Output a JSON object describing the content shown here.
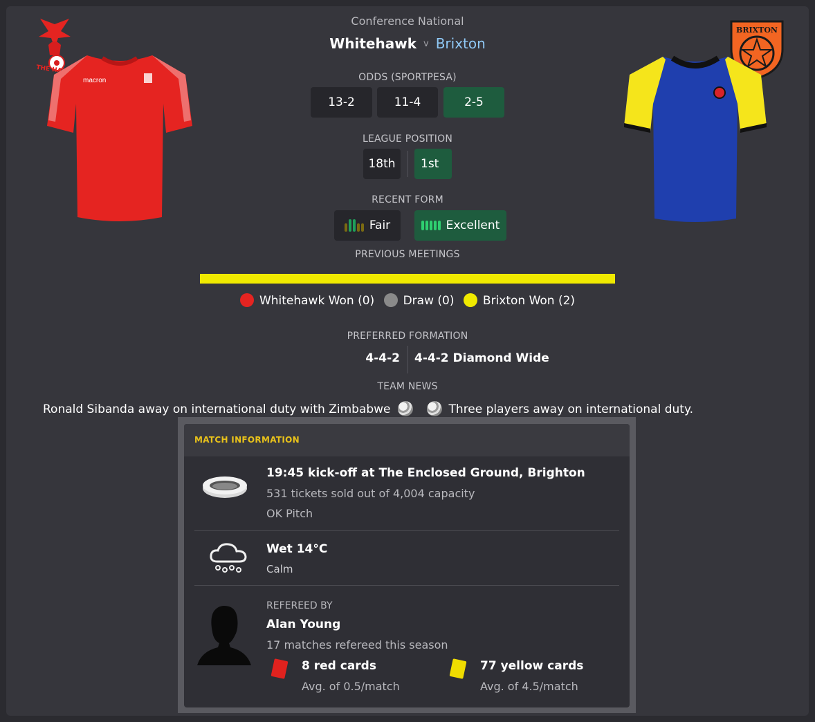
{
  "header": {
    "competition": "Conference National",
    "home_team": "Whitehawk",
    "vs": "v",
    "away_team": "Brixton",
    "home_crest_text": "THE HAWKS",
    "away_crest_text": "BRIXTON"
  },
  "odds": {
    "label": "ODDS (SPORTPESA)",
    "home": "13-2",
    "draw": "11-4",
    "away": "2-5"
  },
  "league_position": {
    "label": "LEAGUE POSITION",
    "home": "18th",
    "away": "1st"
  },
  "recent_form": {
    "label": "RECENT FORM",
    "home": "Fair",
    "away": "Excellent"
  },
  "previous_meetings": {
    "label": "PREVIOUS MEETINGS",
    "home_won": "Whitehawk Won (0)",
    "draw": "Draw (0)",
    "away_won": "Brixton Won (2)",
    "home_wins": 0,
    "draws": 0,
    "away_wins": 2
  },
  "preferred_formation": {
    "label": "PREFERRED FORMATION",
    "home": "4-4-2",
    "away": "4-4-2 Diamond Wide"
  },
  "team_news": {
    "label": "TEAM NEWS",
    "home": "Ronald Sibanda away on international duty with Zimbabwe",
    "away": "Three players away on international duty."
  },
  "match_info": {
    "title": "MATCH INFORMATION",
    "venue": {
      "title": "19:45 kick-off at The Enclosed Ground, Brighton",
      "tickets": "531 tickets sold out of 4,004 capacity",
      "pitch": "OK Pitch"
    },
    "weather": {
      "title": "Wet 14°C",
      "wind": "Calm"
    },
    "referee": {
      "label": "REFEREED BY",
      "name": "Alan Young",
      "matches": "17 matches refereed this season",
      "red_cards": "8 red cards",
      "red_avg": "Avg. of 0.5/match",
      "yellow_cards": "77 yellow cards",
      "yellow_avg": "Avg. of 4.5/match"
    }
  },
  "colors": {
    "accent_green": "#1e5c3e",
    "home_red": "#e52421",
    "away_yellow": "#f0ea00",
    "draw_grey": "#8a8a8a",
    "header_gold": "#e9c21a"
  }
}
